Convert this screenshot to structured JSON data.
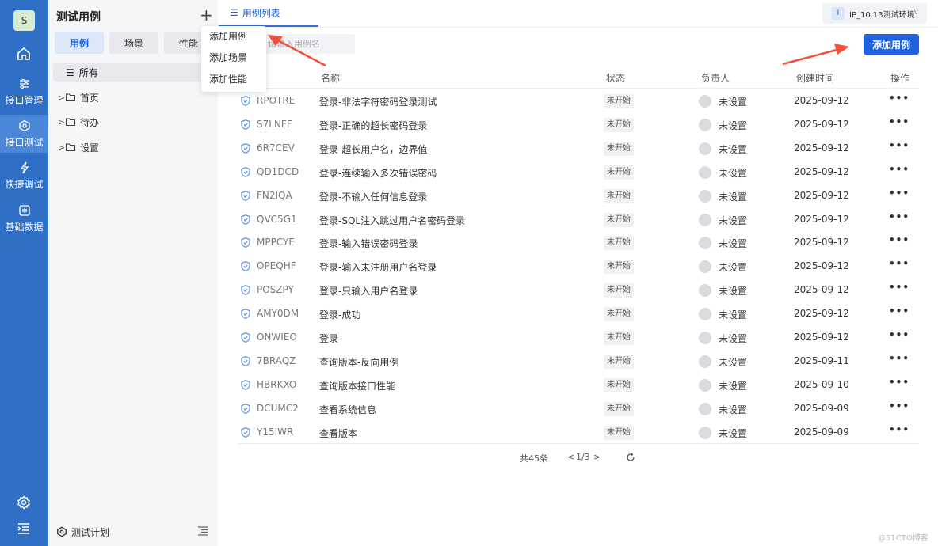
{
  "rail": {
    "avatar": "S",
    "items": [
      {
        "label": "接口管理",
        "icon": "sliders-icon"
      },
      {
        "label": "接口测试",
        "icon": "hexagon-icon"
      },
      {
        "label": "快捷调试",
        "icon": "lightning-icon"
      },
      {
        "label": "基础数据",
        "icon": "data-icon"
      }
    ]
  },
  "panel": {
    "title": "测试用例",
    "segments": [
      "用例",
      "场景",
      "性能"
    ],
    "all_label": "所有",
    "folders": [
      "首页",
      "待办",
      "设置"
    ],
    "footer_label": "测试计划"
  },
  "dropdown": [
    "添加用例",
    "添加场景",
    "添加性能"
  ],
  "main": {
    "tab_label": "用例列表",
    "env_badge": "I",
    "env_label": "IP_10.13测试环境",
    "search_placeholder": "请输入用例名",
    "add_button": "添加用例",
    "columns": [
      "名称",
      "状态",
      "负责人",
      "创建时间",
      "操作"
    ],
    "rows": [
      {
        "id": "RPOTRE",
        "name": "登录-非法字符密码登录测试",
        "status": "未开始",
        "owner": "未设置",
        "date": "2025-09-12"
      },
      {
        "id": "S7LNFF",
        "name": "登录-正确的超长密码登录",
        "status": "未开始",
        "owner": "未设置",
        "date": "2025-09-12"
      },
      {
        "id": "6R7CEV",
        "name": "登录-超长用户名，边界值",
        "status": "未开始",
        "owner": "未设置",
        "date": "2025-09-12"
      },
      {
        "id": "QD1DCD",
        "name": "登录-连续输入多次错误密码",
        "status": "未开始",
        "owner": "未设置",
        "date": "2025-09-12"
      },
      {
        "id": "FN2IQA",
        "name": "登录-不输入任何信息登录",
        "status": "未开始",
        "owner": "未设置",
        "date": "2025-09-12"
      },
      {
        "id": "QVC5G1",
        "name": "登录-SQL注入跳过用户名密码登录",
        "status": "未开始",
        "owner": "未设置",
        "date": "2025-09-12"
      },
      {
        "id": "MPPCYE",
        "name": "登录-输入错误密码登录",
        "status": "未开始",
        "owner": "未设置",
        "date": "2025-09-12"
      },
      {
        "id": "OPEQHF",
        "name": "登录-输入未注册用户名登录",
        "status": "未开始",
        "owner": "未设置",
        "date": "2025-09-12"
      },
      {
        "id": "POSZPY",
        "name": "登录-只输入用户名登录",
        "status": "未开始",
        "owner": "未设置",
        "date": "2025-09-12"
      },
      {
        "id": "AMY0DM",
        "name": "登录-成功",
        "status": "未开始",
        "owner": "未设置",
        "date": "2025-09-12"
      },
      {
        "id": "ONWIEO",
        "name": "登录",
        "status": "未开始",
        "owner": "未设置",
        "date": "2025-09-12"
      },
      {
        "id": "7BRAQZ",
        "name": "查询版本-反向用例",
        "status": "未开始",
        "owner": "未设置",
        "date": "2025-09-11"
      },
      {
        "id": "HBRKXO",
        "name": "查询版本接口性能",
        "status": "未开始",
        "owner": "未设置",
        "date": "2025-09-10"
      },
      {
        "id": "DCUMC2",
        "name": "查看系统信息",
        "status": "未开始",
        "owner": "未设置",
        "date": "2025-09-09"
      },
      {
        "id": "Y15IWR",
        "name": "查看版本",
        "status": "未开始",
        "owner": "未设置",
        "date": "2025-09-09"
      }
    ],
    "more_label": "•••",
    "pager": {
      "total": "共45条",
      "page": "1/3"
    }
  },
  "watermark": "@51CTO博客",
  "colors": {
    "rail": "#2f6fc6",
    "rail_active": "#4a87d8",
    "primary": "#1f62e0",
    "arrow": "#f0513c"
  }
}
